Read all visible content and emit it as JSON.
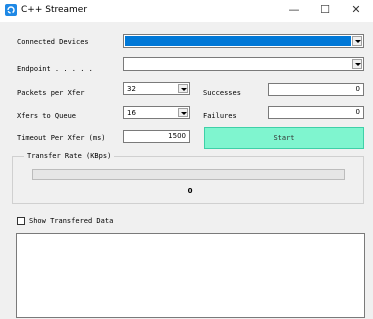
{
  "window": {
    "title": "C++ Streamer",
    "minimize_glyph": "—",
    "maximize_glyph": "☐",
    "close_glyph": "✕"
  },
  "icons": {
    "app": "app-icon",
    "dropdown": "chevron-down-icon"
  },
  "colors": {
    "title_bar": "#ffffff",
    "window_bg": "#f0f0f0",
    "selected_device": "#0078d7",
    "start_button": "#7ff5cf"
  },
  "form": {
    "connected_devices_label": "Connected Devices",
    "endpoint_label": "Endpoint . . . . .",
    "packets_label": "Packets per Xfer",
    "packets_value": "32",
    "xfers_label": "Xfers to Queue",
    "xfers_value": "16",
    "timeout_label": "Timeout Per Xfer (ms)",
    "timeout_value": "1500",
    "successes_label": "Successes",
    "successes_value": "0",
    "failures_label": "Failures",
    "failures_value": "0",
    "start_label": "Start"
  },
  "transfer": {
    "group_label": "Transfer Rate (KBps)",
    "rate_value": "0",
    "progress_fraction": 0
  },
  "data_view": {
    "show_label": "Show Transfered Data",
    "checked": false
  }
}
